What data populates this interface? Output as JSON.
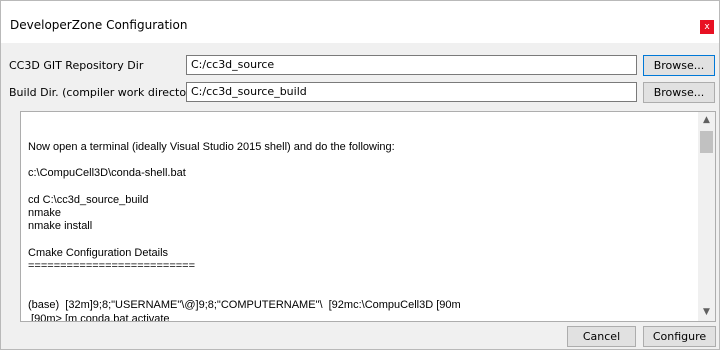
{
  "window": {
    "title": "DeveloperZone Configuration",
    "close_glyph": "x"
  },
  "repo_dir": {
    "label": "CC3D GIT Repository Dir",
    "value": "C:/cc3d_source",
    "browse_label": "Browse..."
  },
  "build_dir": {
    "label": "Build Dir. (compiler work directory)",
    "value": "C:/cc3d_source_build",
    "browse_label": "Browse..."
  },
  "log": {
    "text": "Now open a terminal (ideally Visual Studio 2015 shell) and do the following:\n\nc:\\CompuCell3D\\conda-shell.bat\n\ncd C:\\cc3d_source_build\nnmake\nnmake install\n\nCmake Configuration Details\n==========================\n\n\n(base)  [32m]9;8;\"USERNAME\"\\@]9;8;\"COMPUTERNAME\"\\  [92mc:\\CompuCell3D [90m\n [90m> [m conda.bat activate"
  },
  "buttons": {
    "cancel": "Cancel",
    "configure": "Configure"
  },
  "icons": {
    "scroll_up": "chevron-up-icon",
    "scroll_down": "chevron-down-icon"
  },
  "colors": {
    "close": "#e81123",
    "focus_border": "#0078d7"
  }
}
